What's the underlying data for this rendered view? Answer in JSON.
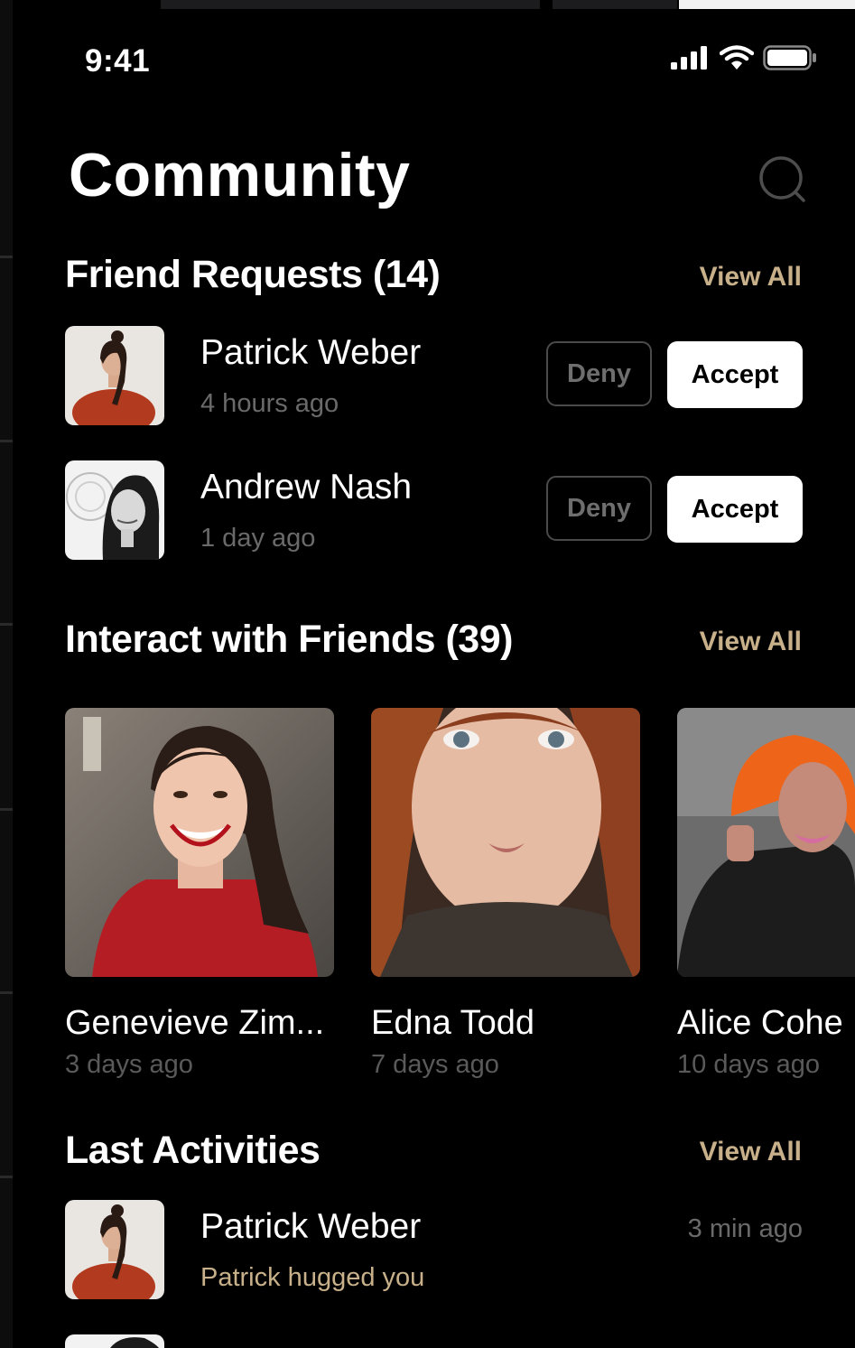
{
  "status_bar": {
    "time": "9:41",
    "icons": [
      "cellular-signal-icon",
      "wifi-icon",
      "battery-icon"
    ]
  },
  "header": {
    "title": "Community",
    "search_icon": "search-icon"
  },
  "friend_requests": {
    "title": "Friend Requests (14)",
    "view_all": "View All",
    "items": [
      {
        "name": "Patrick Weber",
        "time": "4 hours ago",
        "deny": "Deny",
        "accept": "Accept"
      },
      {
        "name": "Andrew Nash",
        "time": "1 day ago",
        "deny": "Deny",
        "accept": "Accept"
      }
    ]
  },
  "interact": {
    "title": "Interact with Friends (39)",
    "view_all": "View All",
    "friends": [
      {
        "name": "Genevieve Zim...",
        "time": "3 days ago"
      },
      {
        "name": "Edna Todd",
        "time": "7 days ago"
      },
      {
        "name": "Alice Cohe",
        "time": "10 days ago"
      }
    ]
  },
  "activities": {
    "title": "Last Activities",
    "view_all": "View All",
    "items": [
      {
        "name": "Patrick Weber",
        "action": "Patrick hugged you",
        "time": "3 min ago"
      }
    ]
  },
  "colors": {
    "background": "#000000",
    "accent": "#c8b18a",
    "muted_text": "#6a6a6a",
    "accept_bg": "#ffffff"
  }
}
